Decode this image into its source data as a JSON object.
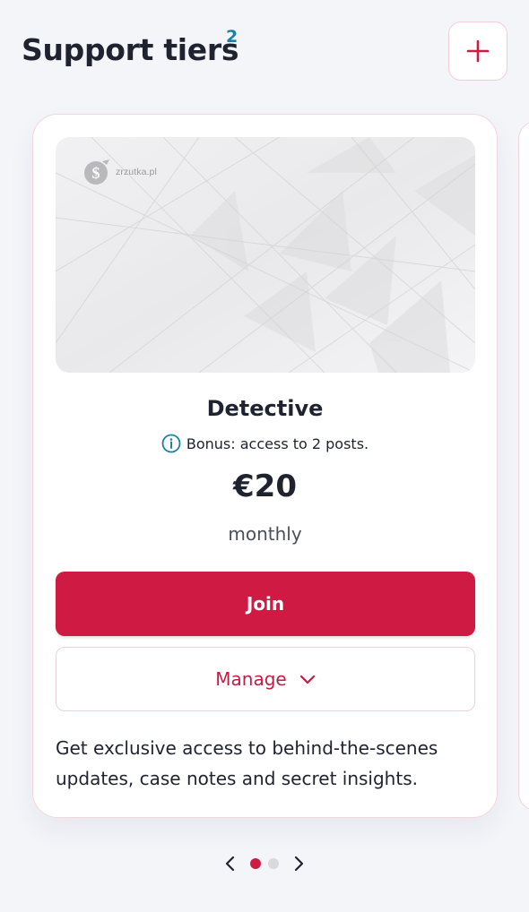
{
  "header": {
    "title": "Support tiers",
    "count": "2",
    "add_icon": "plus-icon"
  },
  "tier": {
    "image_logo_text": "zrzutka.pl",
    "name": "Detective",
    "bonus_icon": "info-icon",
    "bonus_text": "Bonus: access to 2 posts.",
    "price": "€20",
    "period": "monthly",
    "join_label": "Join",
    "manage_label": "Manage",
    "manage_icon": "chevron-down-icon",
    "description": "Get exclusive access to behind-the-scenes updates, case notes and secret insights."
  },
  "pager": {
    "prev_icon": "chevron-left-icon",
    "next_icon": "chevron-right-icon",
    "pages": 2,
    "active_page": 1
  },
  "colors": {
    "accent": "#cf1b43",
    "count": "#1c7fa8",
    "text": "#1f2330"
  }
}
